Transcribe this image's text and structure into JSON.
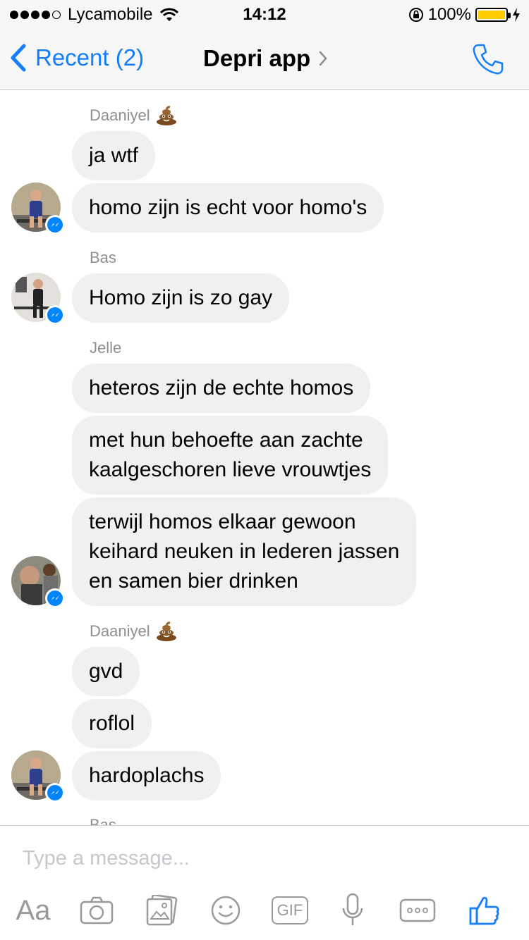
{
  "status_bar": {
    "carrier": "Lycamobile",
    "time": "14:12",
    "battery": "100%"
  },
  "nav": {
    "back_label": "Recent (2)",
    "title": "Depri app"
  },
  "colors": {
    "accent": "#147efb",
    "bubble": "#f1f0f0",
    "messenger_badge": "#0084ff",
    "battery": "#ffcc00"
  },
  "conversation": {
    "senders": {
      "daaniyel_1": "Daaniyel",
      "bas": "Bas",
      "jelle": "Jelle",
      "daaniyel_2": "Daaniyel",
      "bas_partial": "Bas"
    },
    "messages": {
      "m1": "ja wtf",
      "m2": "homo zijn is echt voor homo's",
      "m3": "Homo zijn is zo gay",
      "m4": "heteros zijn de echte homos",
      "m5": "met hun behoefte aan zachte\nkaalgeschoren lieve vrouwtjes",
      "m6": "terwijl homos elkaar gewoon\nkeihard neuken in lederen jassen\nen samen bier drinken",
      "m7": "gvd",
      "m8": "roflol",
      "m9": "hardoplachs"
    }
  },
  "composer": {
    "placeholder": "Type a message...",
    "aa_label": "Aa",
    "gif_label": "GIF"
  }
}
